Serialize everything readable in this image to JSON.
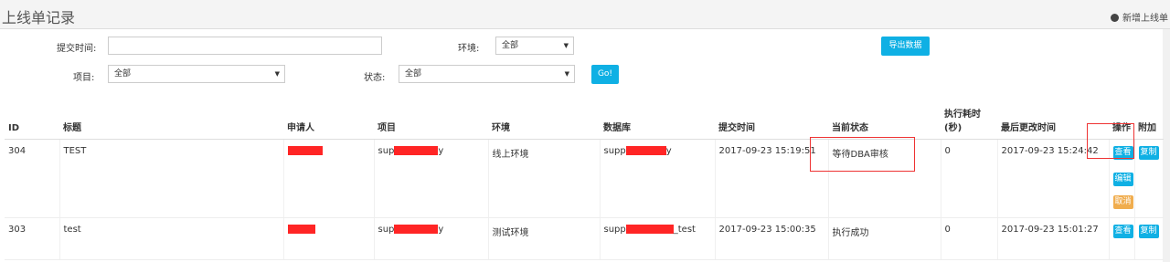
{
  "header": {
    "title": "上线单记录",
    "add_label": "新增上线单"
  },
  "filters": {
    "submit_time_label": "提交时间:",
    "submit_time_value": "",
    "env_label": "环境:",
    "env_value": "全部",
    "export_label": "导出数据",
    "project_label": "项目:",
    "project_value": "全部",
    "status_label": "状态:",
    "status_value": "全部",
    "go_label": "Go!"
  },
  "table": {
    "columns": [
      "ID",
      "标题",
      "申请人",
      "项目",
      "环境",
      "数据库",
      "提交时间",
      "当前状态",
      "执行耗时(秒)",
      "最后更改时间",
      "操作",
      "附加"
    ],
    "col_time_line1": "执行耗时",
    "col_time_line2": "(秒)",
    "rows": [
      {
        "id": "304",
        "title": "TEST",
        "project_prefix": "sup",
        "project_suffix": "y",
        "env": "线上环境",
        "db_prefix": "supp",
        "db_suffix": "y",
        "submit": "2017-09-23 15:19:51",
        "status": "等待DBA审核",
        "elapsed": "0",
        "updated": "2017-09-23 15:24:42",
        "actions": [
          "查看",
          "编辑",
          "取消"
        ],
        "extra": "复制"
      },
      {
        "id": "303",
        "title": "test",
        "project_prefix": "sup",
        "project_suffix": "y",
        "env": "测试环境",
        "db_prefix": "supp",
        "db_suffix": "_test",
        "submit": "2017-09-23 15:00:35",
        "status": "执行成功",
        "elapsed": "0",
        "updated": "2017-09-23 15:01:27",
        "actions": [
          "查看"
        ],
        "extra": "复制"
      }
    ]
  },
  "colors": {
    "accent": "#0fb0e4",
    "warning": "#f0ad4e",
    "redaction": "#ff2525"
  }
}
